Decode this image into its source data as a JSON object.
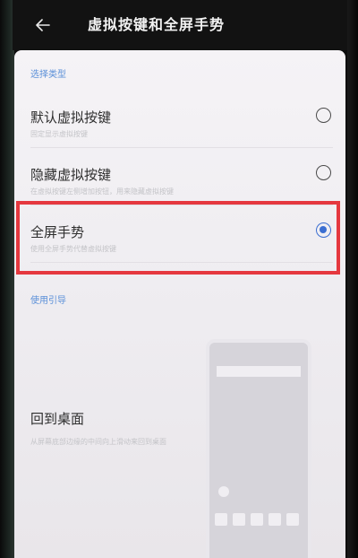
{
  "header": {
    "title": "虚拟按键和全屏手势",
    "back_icon": "arrow-left-icon"
  },
  "section": {
    "label": "选择类型"
  },
  "options": [
    {
      "label": "默认虚拟按键",
      "desc": "固定显示虚拟按键",
      "selected": false
    },
    {
      "label": "隐藏虚拟按键",
      "desc": "在虚拟按键左侧增加按钮，用来隐藏虚拟按键",
      "selected": false
    },
    {
      "label": "全屏手势",
      "desc": "使用全屏手势代替虚拟按键",
      "selected": true
    }
  ],
  "guide": {
    "label": "使用引导",
    "title": "回到桌面",
    "desc": "从屏幕底部边缘的中间向上滑动来回到桌面"
  },
  "colors": {
    "accent": "#3b6ed1",
    "highlight": "#e5383f",
    "section_label": "#5a8fd8"
  }
}
